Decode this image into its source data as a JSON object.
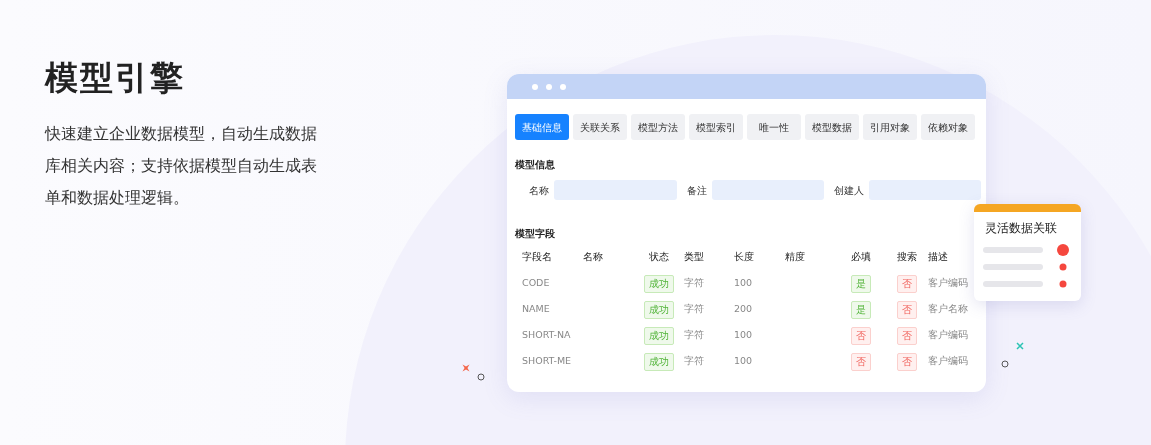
{
  "hero": {
    "title": "模型引擎",
    "description": "快速建立企业数据模型，自动生成数据库相关内容；支持依据模型自动生成表单和数据处理逻辑。"
  },
  "tabs": [
    {
      "label": "基础信息",
      "selected": true
    },
    {
      "label": "关联关系",
      "selected": false
    },
    {
      "label": "模型方法",
      "selected": false
    },
    {
      "label": "模型索引",
      "selected": false
    },
    {
      "label": "唯一性",
      "selected": false
    },
    {
      "label": "模型数据",
      "selected": false
    },
    {
      "label": "引用对象",
      "selected": false
    },
    {
      "label": "依赖对象",
      "selected": false
    }
  ],
  "model_info": {
    "heading": "模型信息",
    "fields": [
      {
        "label": "名称"
      },
      {
        "label": "备注"
      },
      {
        "label": "创建人"
      }
    ]
  },
  "model_fields": {
    "heading": "模型字段",
    "columns": [
      "字段名",
      "名称",
      "状态",
      "类型",
      "长度",
      "精度",
      "必填",
      "搜索",
      "描述"
    ],
    "rows": [
      {
        "field": "CODE",
        "status": {
          "text": "成功",
          "kind": "yes"
        },
        "type": "字符",
        "length": "100",
        "required": {
          "text": "是",
          "kind": "yes"
        },
        "search": {
          "text": "否",
          "kind": "no"
        },
        "description": "客户编码"
      },
      {
        "field": "NAME",
        "status": {
          "text": "成功",
          "kind": "yes"
        },
        "type": "字符",
        "length": "200",
        "required": {
          "text": "是",
          "kind": "yes"
        },
        "search": {
          "text": "否",
          "kind": "no"
        },
        "description": "客户名称"
      },
      {
        "field": "SHORT-NA",
        "status": {
          "text": "成功",
          "kind": "yes"
        },
        "type": "字符",
        "length": "100",
        "required": {
          "text": "否",
          "kind": "no"
        },
        "search": {
          "text": "否",
          "kind": "no"
        },
        "description": "客户编码"
      },
      {
        "field": "SHORT-ME",
        "status": {
          "text": "成功",
          "kind": "yes"
        },
        "type": "字符",
        "length": "100",
        "required": {
          "text": "否",
          "kind": "no"
        },
        "search": {
          "text": "否",
          "kind": "no"
        },
        "description": "客户编码"
      }
    ]
  },
  "float_card": {
    "title": "灵活数据关联"
  }
}
